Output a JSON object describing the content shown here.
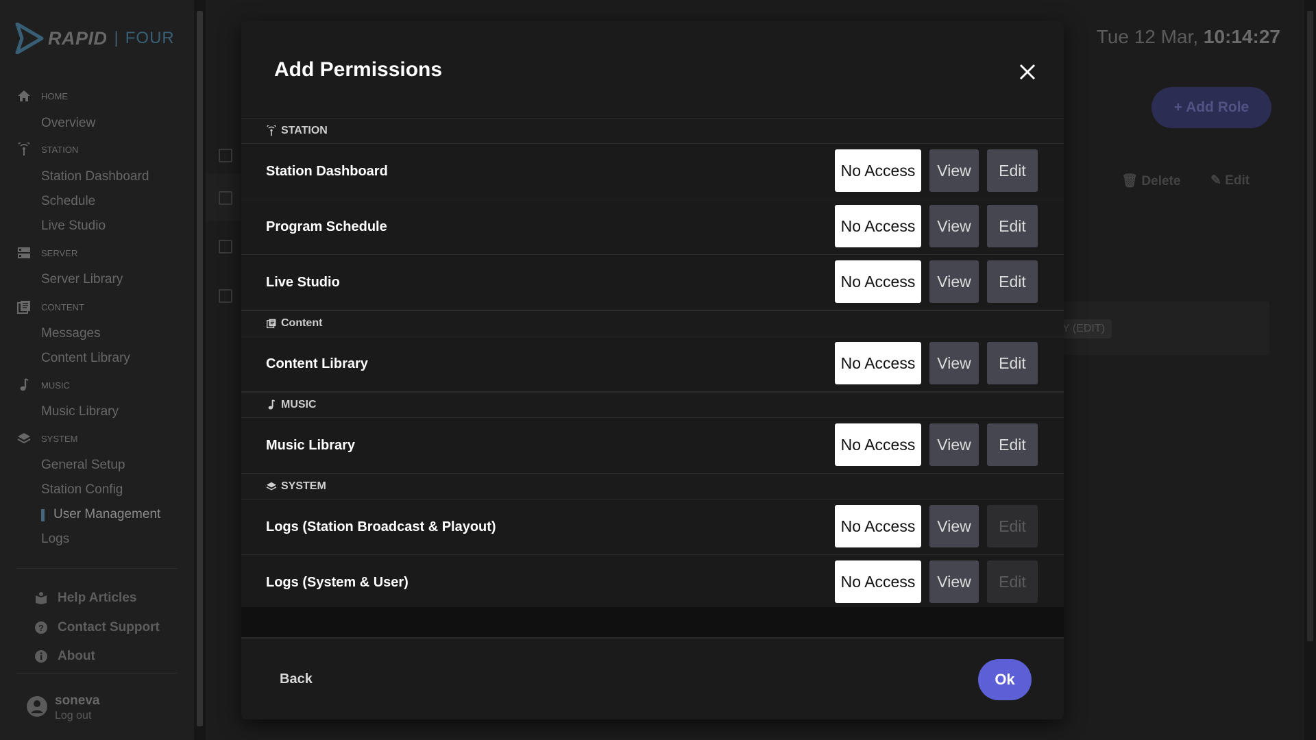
{
  "app": {
    "logo_brand": "RAPID",
    "logo_sep": "|",
    "logo_product": "FOUR"
  },
  "sidebar": {
    "sections": [
      {
        "label": "HOME",
        "icon": "home-icon",
        "items": [
          "Overview"
        ]
      },
      {
        "label": "STATION",
        "icon": "broadcast-icon",
        "items": [
          "Station Dashboard",
          "Schedule",
          "Live Studio"
        ]
      },
      {
        "label": "SERVER",
        "icon": "server-icon",
        "items": [
          "Server Library"
        ]
      },
      {
        "label": "CONTENT",
        "icon": "content-icon",
        "items": [
          "Messages",
          "Content Library"
        ]
      },
      {
        "label": "MUSIC",
        "icon": "music-note-icon",
        "items": [
          "Music Library"
        ]
      },
      {
        "label": "SYSTEM",
        "icon": "layers-icon",
        "items": [
          "General Setup",
          "Station Config",
          "User Management",
          "Logs"
        ]
      }
    ],
    "active_item": "User Management",
    "footer": [
      {
        "label": "Help Articles",
        "icon": "help-articles-icon"
      },
      {
        "label": "Contact Support",
        "icon": "support-icon"
      },
      {
        "label": "About",
        "icon": "info-icon"
      }
    ],
    "user": {
      "name": "soneva",
      "logout": "Log out"
    }
  },
  "header": {
    "date": "Tue 12 Mar,",
    "time": "10:14:27"
  },
  "background": {
    "add_role": "+ Add Role",
    "delete": "Delete",
    "edit": "Edit",
    "chip": "Y (EDIT)"
  },
  "modal": {
    "title": "Add Permissions",
    "groups": [
      {
        "name": "STATION",
        "icon": "broadcast-icon",
        "rows": [
          {
            "label": "Station Dashboard",
            "edit_enabled": true
          },
          {
            "label": "Program Schedule",
            "edit_enabled": true
          },
          {
            "label": "Live Studio",
            "edit_enabled": true
          }
        ]
      },
      {
        "name": "Content",
        "icon": "content-icon",
        "rows": [
          {
            "label": "Content Library",
            "edit_enabled": true
          }
        ]
      },
      {
        "name": "MUSIC",
        "icon": "music-note-icon",
        "rows": [
          {
            "label": "Music Library",
            "edit_enabled": true
          }
        ]
      },
      {
        "name": "SYSTEM",
        "icon": "layers-icon",
        "rows": [
          {
            "label": "Logs (Station Broadcast & Playout)",
            "edit_enabled": false
          },
          {
            "label": "Logs (System & User)",
            "edit_enabled": false
          }
        ]
      }
    ],
    "options": {
      "no_access": "No Access",
      "view": "View",
      "edit": "Edit"
    },
    "selected": "No Access",
    "back": "Back",
    "ok": "Ok"
  },
  "colors": {
    "accent": "#5d5fd6",
    "brand": "#4d7f9f",
    "modal_bg": "#1b1b1c"
  }
}
